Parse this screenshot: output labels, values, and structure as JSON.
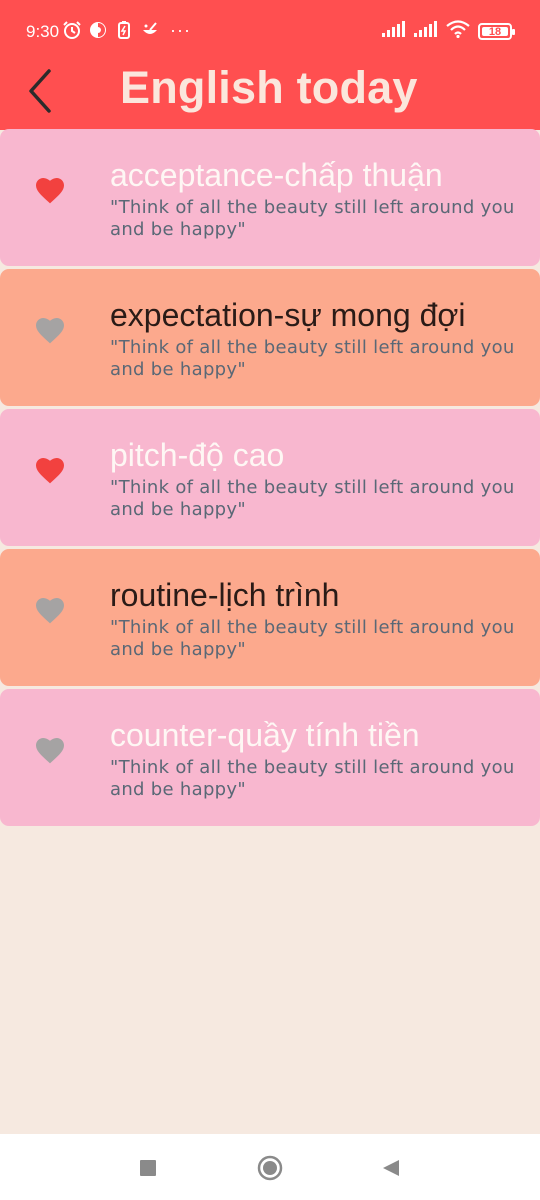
{
  "status_bar": {
    "time": "9:30",
    "more": "···",
    "battery": "18"
  },
  "app_bar": {
    "title": "English today"
  },
  "words": [
    {
      "word": "acceptance-chấp thuận",
      "quote": "\"Think of all the beauty still left around you and be happy\"",
      "favorite": true,
      "style": "pink"
    },
    {
      "word": "expectation-sự mong đợi",
      "quote": "\"Think of all the beauty still left around you and be happy\"",
      "favorite": false,
      "style": "salmon"
    },
    {
      "word": "pitch-độ cao",
      "quote": "\"Think of all the beauty still left around you and be happy\"",
      "favorite": true,
      "style": "pink"
    },
    {
      "word": "routine-lịch trình",
      "quote": "\"Think of all the beauty still left around you and be happy\"",
      "favorite": false,
      "style": "salmon"
    },
    {
      "word": "counter-quầy tính tiền",
      "quote": "\"Think of all the beauty still left around you and be happy\"",
      "favorite": false,
      "style": "pink"
    }
  ],
  "colors": {
    "header": "#ff4f50",
    "background": "#f6e9e0",
    "card_pink": "#f8b7cf",
    "card_salmon": "#fca98d",
    "heart_active": "#f2413f",
    "heart_inactive": "#a5a3a3"
  }
}
